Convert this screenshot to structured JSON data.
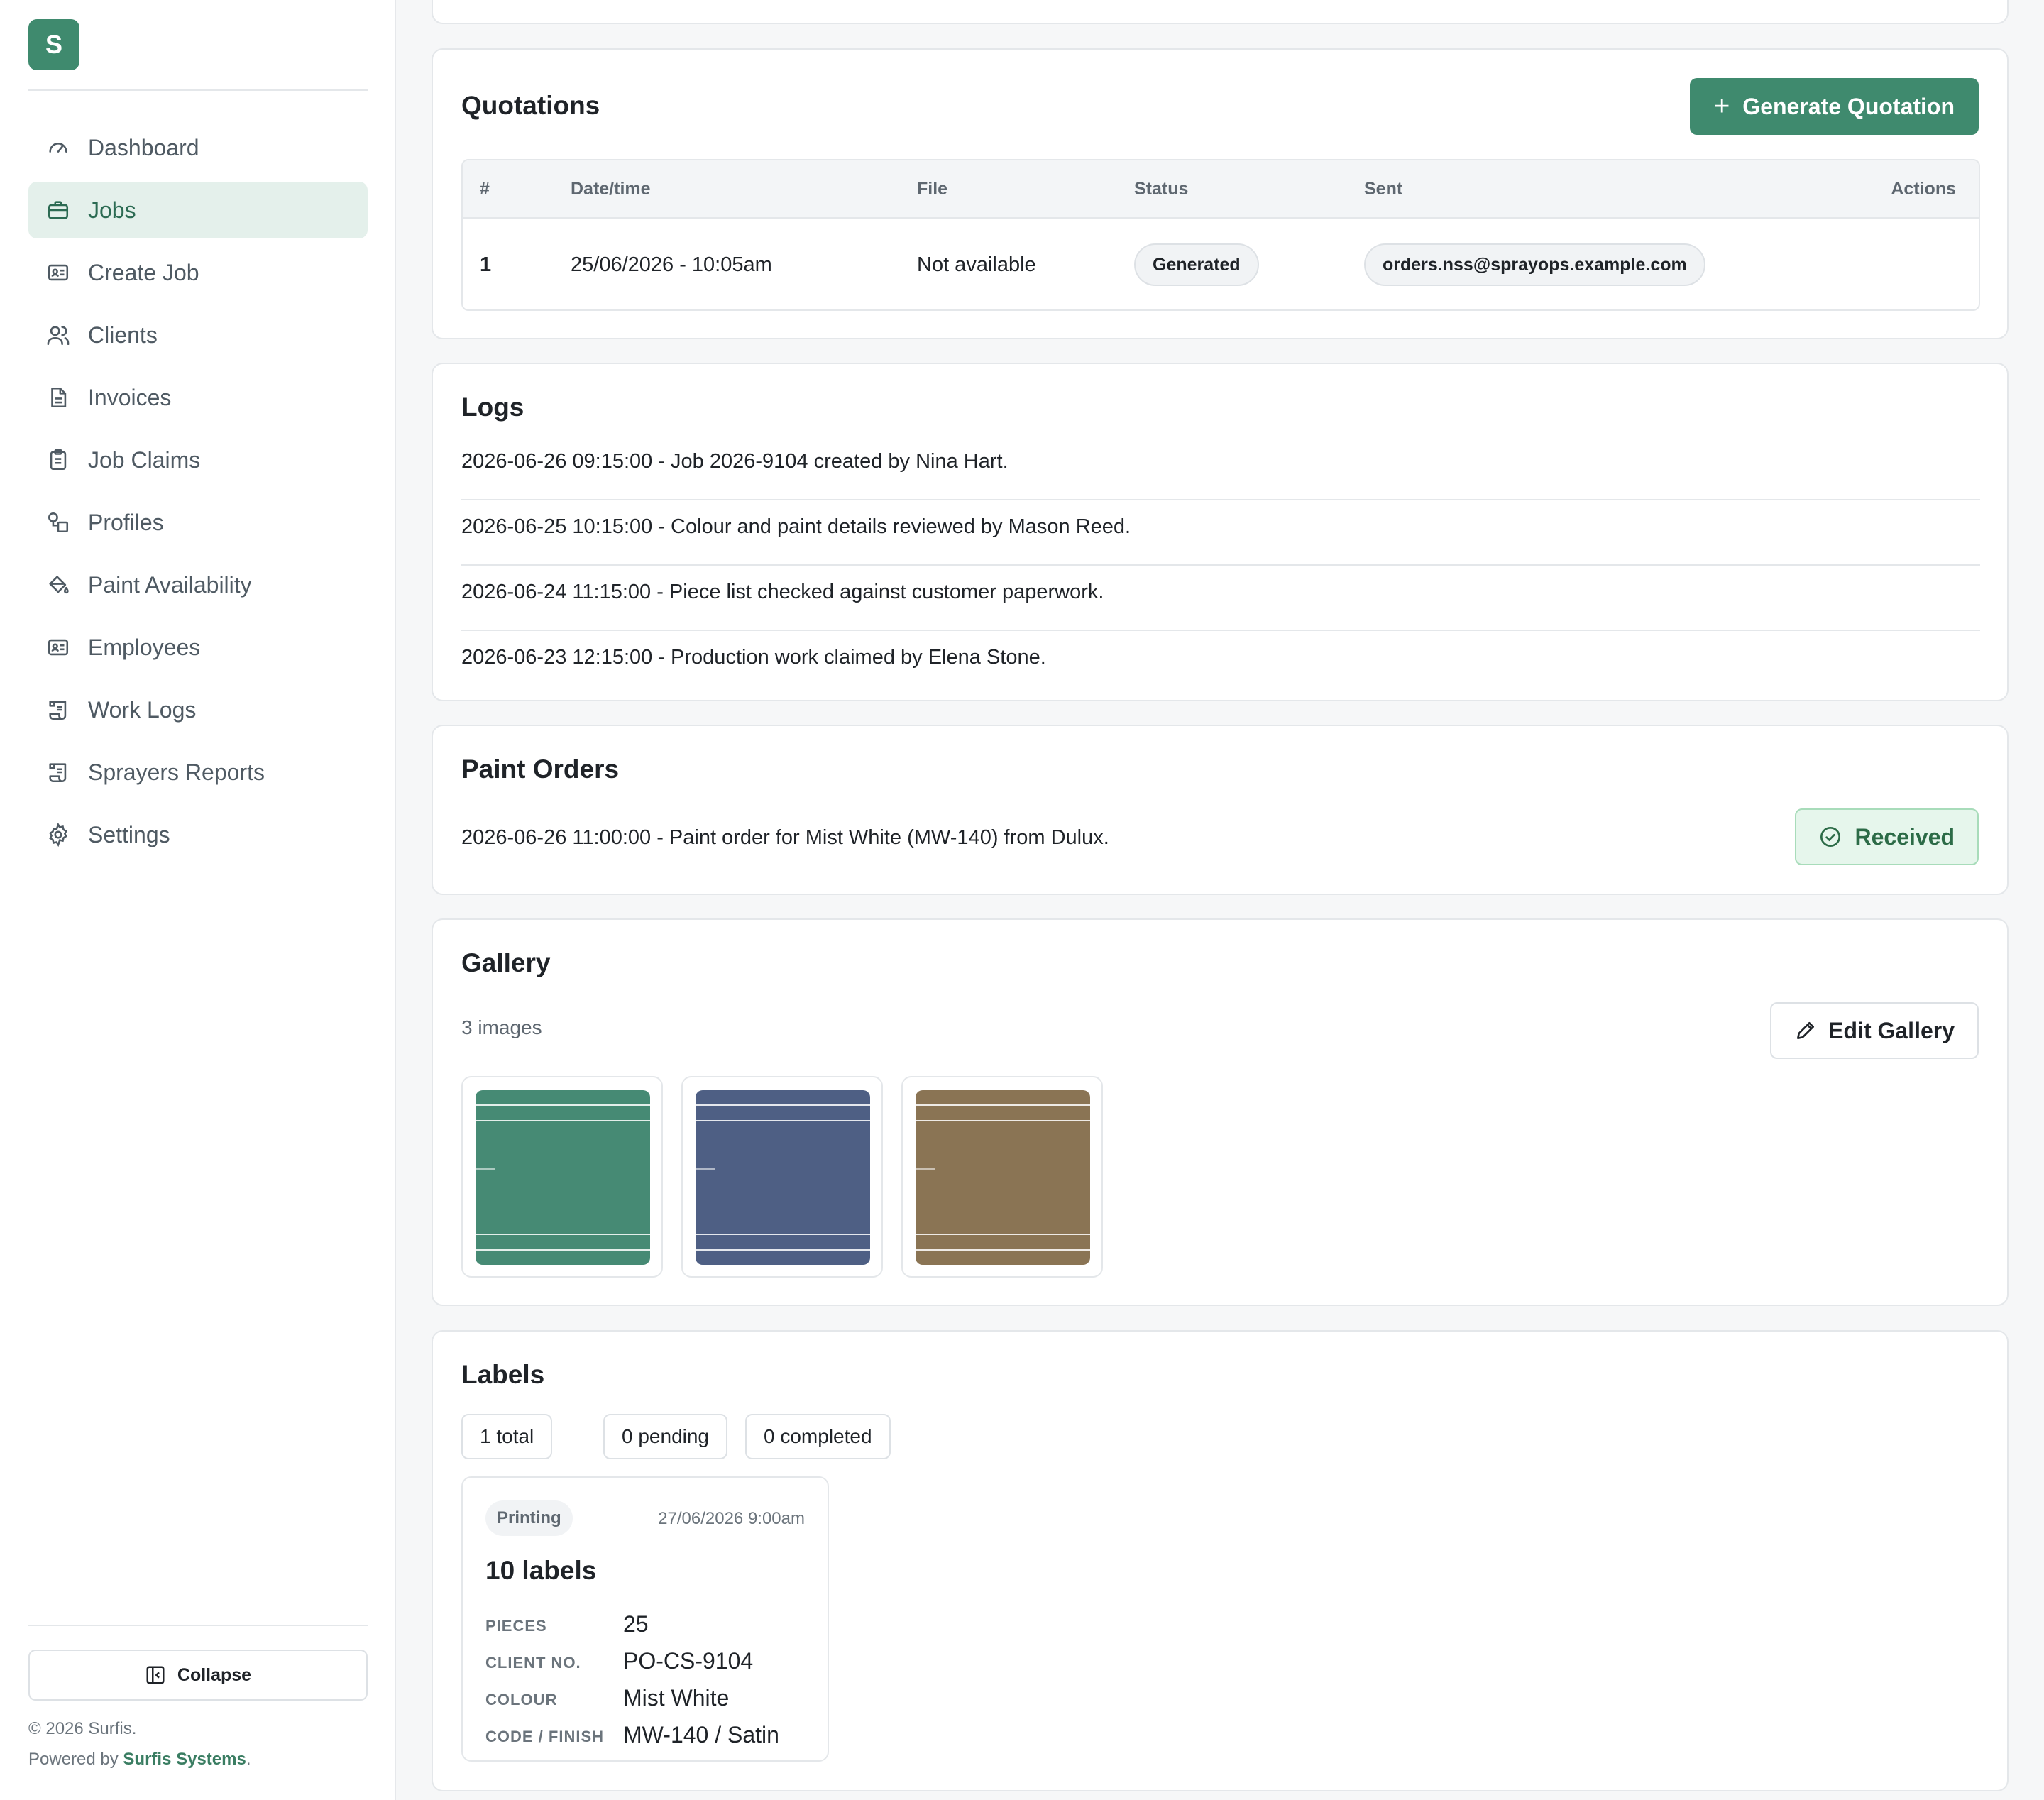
{
  "app": {
    "logo_letter": "S",
    "accent_color": "#3f8a6e"
  },
  "sidebar": {
    "items": [
      {
        "label": "Dashboard",
        "icon": "gauge-icon",
        "active": false
      },
      {
        "label": "Jobs",
        "icon": "briefcase-icon",
        "active": true
      },
      {
        "label": "Create Job",
        "icon": "id-card-icon",
        "active": false
      },
      {
        "label": "Clients",
        "icon": "users-icon",
        "active": false
      },
      {
        "label": "Invoices",
        "icon": "file-text-icon",
        "active": false
      },
      {
        "label": "Job Claims",
        "icon": "clipboard-icon",
        "active": false
      },
      {
        "label": "Profiles",
        "icon": "shapes-icon",
        "active": false
      },
      {
        "label": "Paint Availability",
        "icon": "paint-bucket-icon",
        "active": false
      },
      {
        "label": "Employees",
        "icon": "id-card-icon",
        "active": false
      },
      {
        "label": "Work Logs",
        "icon": "scroll-icon",
        "active": false
      },
      {
        "label": "Sprayers Reports",
        "icon": "scroll-icon",
        "active": false
      },
      {
        "label": "Settings",
        "icon": "gear-icon",
        "active": false
      }
    ],
    "collapse_label": "Collapse",
    "copyright": "© 2026 Surfis.",
    "powered_prefix": "Powered by ",
    "powered_brand": "Surfis Systems",
    "powered_suffix": "."
  },
  "quotations": {
    "title": "Quotations",
    "generate_label": "Generate Quotation",
    "columns": [
      "#",
      "Date/time",
      "File",
      "Status",
      "Sent",
      "Actions"
    ],
    "rows": [
      {
        "num": "1",
        "datetime": "25/06/2026 - 10:05am",
        "file": "Not available",
        "status": "Generated",
        "sent": "orders.nss@sprayops.example.com"
      }
    ]
  },
  "logs": {
    "title": "Logs",
    "entries": [
      "2026-06-26 09:15:00 - Job 2026-9104 created by Nina Hart.",
      "2026-06-25 10:15:00 - Colour and paint details reviewed by Mason Reed.",
      "2026-06-24 11:15:00 - Piece list checked against customer paperwork.",
      "2026-06-23 12:15:00 - Production work claimed by Elena Stone."
    ]
  },
  "paint_orders": {
    "title": "Paint Orders",
    "entry": "2026-06-26 11:00:00 - Paint order for Mist White (MW-140) from Dulux.",
    "status": "Received",
    "status_color": "#2c6b47"
  },
  "gallery": {
    "title": "Gallery",
    "count_text": "3 images",
    "edit_label": "Edit Gallery",
    "images": [
      {
        "color": "#468a74"
      },
      {
        "color": "#4e5f84"
      },
      {
        "color": "#8a7454"
      }
    ]
  },
  "labels": {
    "title": "Labels",
    "stats": {
      "total": "1 total",
      "pending": "0 pending",
      "completed": "0 completed"
    },
    "card": {
      "status": "Printing",
      "date": "27/06/2026 9:00am",
      "title": "10 labels",
      "pieces_key": "PIECES",
      "pieces": "25",
      "client_key": "CLIENT NO.",
      "client": "PO-CS-9104",
      "colour_key": "COLOUR",
      "colour": "Mist White",
      "code_key": "CODE / FINISH",
      "code": "MW-140 / Satin"
    }
  }
}
